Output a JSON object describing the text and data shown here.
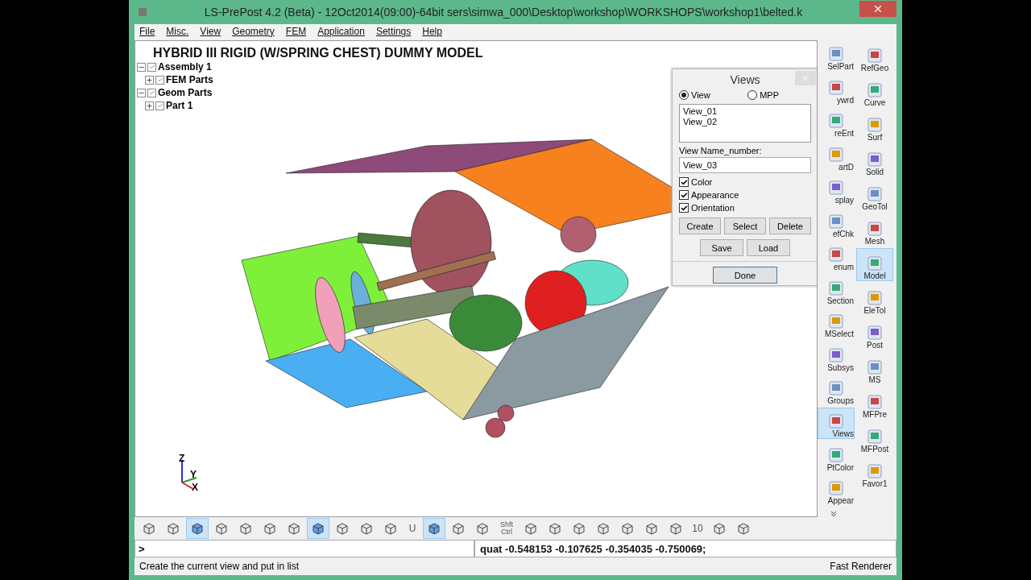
{
  "window": {
    "title": "LS-PrePost 4.2 (Beta) - 12Oct2014(09:00)-64bit sers\\simwa_000\\Desktop\\workshop\\WORKSHOPS\\workshop1\\belted.k"
  },
  "menu": [
    "File",
    "Misc.",
    "View",
    "Geometry",
    "FEM",
    "Application",
    "Settings",
    "Help"
  ],
  "viewport": {
    "title": "HYBRID III RIGID (W/SPRING CHEST) DUMMY MODEL",
    "tree": [
      {
        "label": "Assembly 1",
        "checked": true,
        "expanded": true,
        "children": [
          {
            "label": "FEM Parts",
            "checked": true,
            "expanded": false
          }
        ]
      },
      {
        "label": "Geom Parts",
        "checked": true,
        "expanded": true,
        "children": [
          {
            "label": "Part 1",
            "checked": true,
            "expanded": false
          }
        ]
      }
    ],
    "axes": [
      "Z",
      "Y",
      "X"
    ]
  },
  "views_dialog": {
    "title": "Views",
    "modes": [
      {
        "label": "View",
        "selected": true
      },
      {
        "label": "MPP",
        "selected": false
      }
    ],
    "list": [
      "View_01",
      "View_02"
    ],
    "name_label": "View Name_number:",
    "name_value": "View_03",
    "options": [
      {
        "label": "Color",
        "checked": true
      },
      {
        "label": "Appearance",
        "checked": true
      },
      {
        "label": "Orientation",
        "checked": true
      }
    ],
    "buttons_row_1": [
      "Create",
      "Select",
      "Delete"
    ],
    "buttons_row_2": [
      "Save",
      "Load"
    ],
    "done": "Done"
  },
  "side_toolbar": [
    [
      {
        "label": "SelPart",
        "selected": false
      },
      {
        "label": "ywrd",
        "selected": false
      },
      {
        "label": "reEnt",
        "selected": false
      },
      {
        "label": "artD",
        "selected": false
      },
      {
        "label": "splay",
        "selected": false
      },
      {
        "label": "efChk",
        "selected": false
      },
      {
        "label": "enum",
        "selected": false
      },
      {
        "label": "Section",
        "selected": false
      },
      {
        "label": "MSelect",
        "selected": false
      },
      {
        "label": "Subsys",
        "selected": false
      },
      {
        "label": "Groups",
        "selected": false
      },
      {
        "label": "Views",
        "selected": true
      },
      {
        "label": "PtColor",
        "selected": false
      },
      {
        "label": "Appear",
        "selected": false
      }
    ],
    [
      {
        "label": "RefGeo",
        "selected": false
      },
      {
        "label": "Curve",
        "selected": false
      },
      {
        "label": "Surf",
        "selected": false
      },
      {
        "label": "Solid",
        "selected": false
      },
      {
        "label": "GeoTol",
        "selected": false
      },
      {
        "label": "Mesh",
        "selected": false
      },
      {
        "label": "Model",
        "selected": true
      },
      {
        "label": "EleTol",
        "selected": false
      },
      {
        "label": "Post",
        "selected": false
      },
      {
        "label": "MS",
        "selected": false
      },
      {
        "label": "MFPre",
        "selected": false
      },
      {
        "label": "MFPost",
        "selected": false
      },
      {
        "label": "Favor1",
        "selected": false
      }
    ]
  ],
  "bottom_toolbar": [
    {
      "kind": "icon",
      "selected": false
    },
    {
      "kind": "icon",
      "selected": false
    },
    {
      "kind": "icon",
      "selected": true
    },
    {
      "kind": "icon",
      "selected": false
    },
    {
      "kind": "icon",
      "selected": false
    },
    {
      "kind": "icon",
      "selected": false
    },
    {
      "kind": "icon",
      "selected": false
    },
    {
      "kind": "icon",
      "selected": true
    },
    {
      "kind": "icon",
      "selected": false
    },
    {
      "kind": "icon",
      "selected": false
    },
    {
      "kind": "icon",
      "selected": false
    },
    {
      "kind": "text",
      "label": "U"
    },
    {
      "kind": "icon",
      "selected": true
    },
    {
      "kind": "icon",
      "selected": false
    },
    {
      "kind": "icon",
      "selected": false
    },
    {
      "kind": "text",
      "label": "Shft Ctrl"
    },
    {
      "kind": "icon",
      "selected": false
    },
    {
      "kind": "icon",
      "selected": false
    },
    {
      "kind": "icon",
      "selected": false
    },
    {
      "kind": "icon",
      "selected": false
    },
    {
      "kind": "icon",
      "selected": false
    },
    {
      "kind": "icon",
      "selected": false
    },
    {
      "kind": "icon",
      "selected": false
    },
    {
      "kind": "text",
      "label": "10"
    },
    {
      "kind": "icon",
      "selected": false
    },
    {
      "kind": "icon",
      "selected": false
    }
  ],
  "command_line": {
    "prompt": ">",
    "value": "quat -0.548153 -0.107625 -0.354035 -0.750069;"
  },
  "status_bar": {
    "message": "Create the current view and put in list",
    "renderer": "Fast Renderer"
  }
}
